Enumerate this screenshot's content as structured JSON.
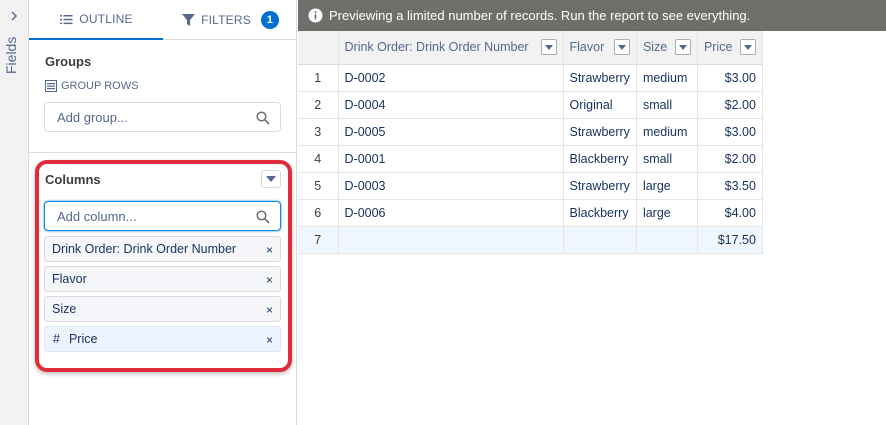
{
  "rail": {
    "label": "Fields"
  },
  "tabs": {
    "outline": "OUTLINE",
    "filters": "FILTERS",
    "filters_count": "1"
  },
  "groups": {
    "title": "Groups",
    "group_rows_label": "GROUP ROWS",
    "placeholder": "Add group..."
  },
  "columns": {
    "title": "Columns",
    "placeholder": "Add column...",
    "items": [
      {
        "label": "Drink Order: Drink Order Number",
        "prefix": ""
      },
      {
        "label": "Flavor",
        "prefix": ""
      },
      {
        "label": "Size",
        "prefix": ""
      },
      {
        "label": "Price",
        "prefix": "#"
      }
    ],
    "remove_glyph": "×"
  },
  "banner": {
    "text": "Previewing a limited number of records. Run the report to see everything."
  },
  "table": {
    "headers": [
      "Drink Order: Drink Order Number",
      "Flavor",
      "Size",
      "Price"
    ],
    "rows": [
      {
        "n": "1",
        "order": "D-0002",
        "flavor": "Strawberry",
        "size": "medium",
        "price": "$3.00"
      },
      {
        "n": "2",
        "order": "D-0004",
        "flavor": "Original",
        "size": "small",
        "price": "$2.00"
      },
      {
        "n": "3",
        "order": "D-0005",
        "flavor": "Strawberry",
        "size": "medium",
        "price": "$3.00"
      },
      {
        "n": "4",
        "order": "D-0001",
        "flavor": "Blackberry",
        "size": "small",
        "price": "$2.00"
      },
      {
        "n": "5",
        "order": "D-0003",
        "flavor": "Strawberry",
        "size": "large",
        "price": "$3.50"
      },
      {
        "n": "6",
        "order": "D-0006",
        "flavor": "Blackberry",
        "size": "large",
        "price": "$4.00"
      }
    ],
    "total": {
      "n": "7",
      "price": "$17.50"
    }
  },
  "colors": {
    "accent": "#0070d2",
    "highlight": "#e02c3a",
    "banner_bg": "#706e6b"
  }
}
